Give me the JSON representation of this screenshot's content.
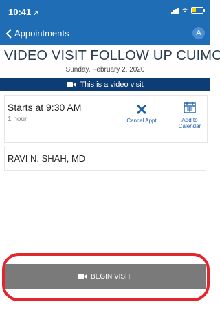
{
  "status_bar": {
    "time": "10:41",
    "location_icon": "location-arrow-icon"
  },
  "nav": {
    "back_label": "Appointments",
    "avatar_initial": "A"
  },
  "appointment": {
    "title": "VIDEO VISIT FOLLOW UP CUIMC",
    "date": "Sunday, February 2, 2020",
    "banner": "This is a video visit",
    "starts": "Starts at 9:30 AM",
    "duration": "1 hour",
    "cancel_label": "Cancel Appt",
    "calendar_label_1": "Add to",
    "calendar_label_2": "Calendar",
    "provider": "RAVI N. SHAH, MD"
  },
  "actions": {
    "begin_label": "BEGIN VISIT"
  },
  "colors": {
    "header": "#1f6db5",
    "banner": "#0e3c75",
    "accent": "#1f5fa8",
    "highlight": "#e3262d",
    "button": "#7a7a7a"
  }
}
